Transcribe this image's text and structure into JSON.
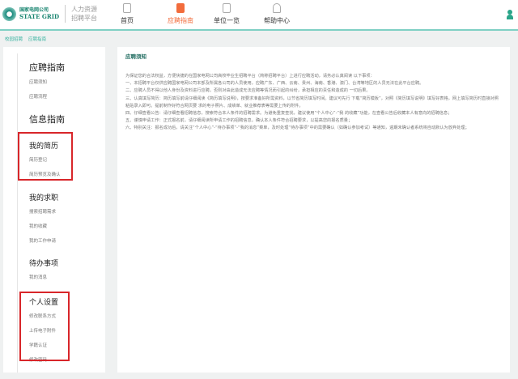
{
  "header": {
    "logo_cn": "国家电网公司",
    "logo_en": "STATE GRID",
    "subtitle_1": "人力资源",
    "subtitle_2": "招聘平台",
    "nav": [
      {
        "label": "首页"
      },
      {
        "label": "应聘指南"
      },
      {
        "label": "单位一览"
      },
      {
        "label": "帮助中心"
      }
    ]
  },
  "breadcrumb": [
    "校园招聘",
    "应聘指南"
  ],
  "sidebar": {
    "sections": [
      {
        "title": "应聘指南",
        "items": [
          "应聘须知",
          "应聘流程"
        ]
      },
      {
        "title": "信息指南",
        "items": []
      },
      {
        "title": "我的简历",
        "items": [
          "简历登记",
          "简历预览及确认"
        ]
      },
      {
        "title": "我的求职",
        "items": [
          "搜索招聘需求",
          "我的收藏",
          "我的工作申请"
        ]
      },
      {
        "title": "待办事项",
        "items": [
          "我的消息"
        ]
      },
      {
        "title": "个人设置",
        "items": [
          "修改联系方式",
          "上传电子附件",
          "学籍认证",
          "修改密码"
        ]
      }
    ]
  },
  "main": {
    "title": "应聘须知",
    "paragraphs": [
      "为保证您的合法权益，方便快捷的在国家电网公司高校毕业生招聘平台（简称招聘平台）上进行应聘活动，请务必认真阅读 以下事项：",
      "一、本招聘平台仅供应聘国家电网公司本部及所属各公司的人员使用，应聘广东、广西、云南、贵州、海南、香港、澳门、台湾等地区的人员无法在此平台应聘。",
      "二、应聘人员不得以他人身份及资料进行应聘，否则对由此造成无法应聘等情况而引起的纠纷，承担相应的责任和造成的 一切后果。",
      "三、认真填写简历：简历填写前请仔细阅读《简历填写说明》，按要求准备好所需资料，以节省简历填写时间。建议可先行 下载“简历模板”，对照《简历填写说明》填写好表格，网上填写简历时直接对照粘贴录入即可。提前制作好符合网页要 求的电子照片、成绩单、就业推荐表等需要上传的附件。",
      "四、仔细查看公告：请仔细查看招聘信息，搜索符合本人条件的招聘需求。为避免重复查找，建议使用“个人中心”-“我 的收藏”功能，在查看公告后收藏本人有意向的招聘信息；",
      "五、谨慎申请工作：正式报名前，请仔细阅读所申请工作的招聘信息，确认本人条件符合招聘要求，以提高您的报名质量；",
      "六、特别关注：报名成功后，请关注“个人中心”-“待办事项”-“我的消息”菜单，及时处理“待办事项”中的需要确认（如确认参加考试）等通知，逾期未确认者系统将自动默认为放弃处理；"
    ]
  }
}
